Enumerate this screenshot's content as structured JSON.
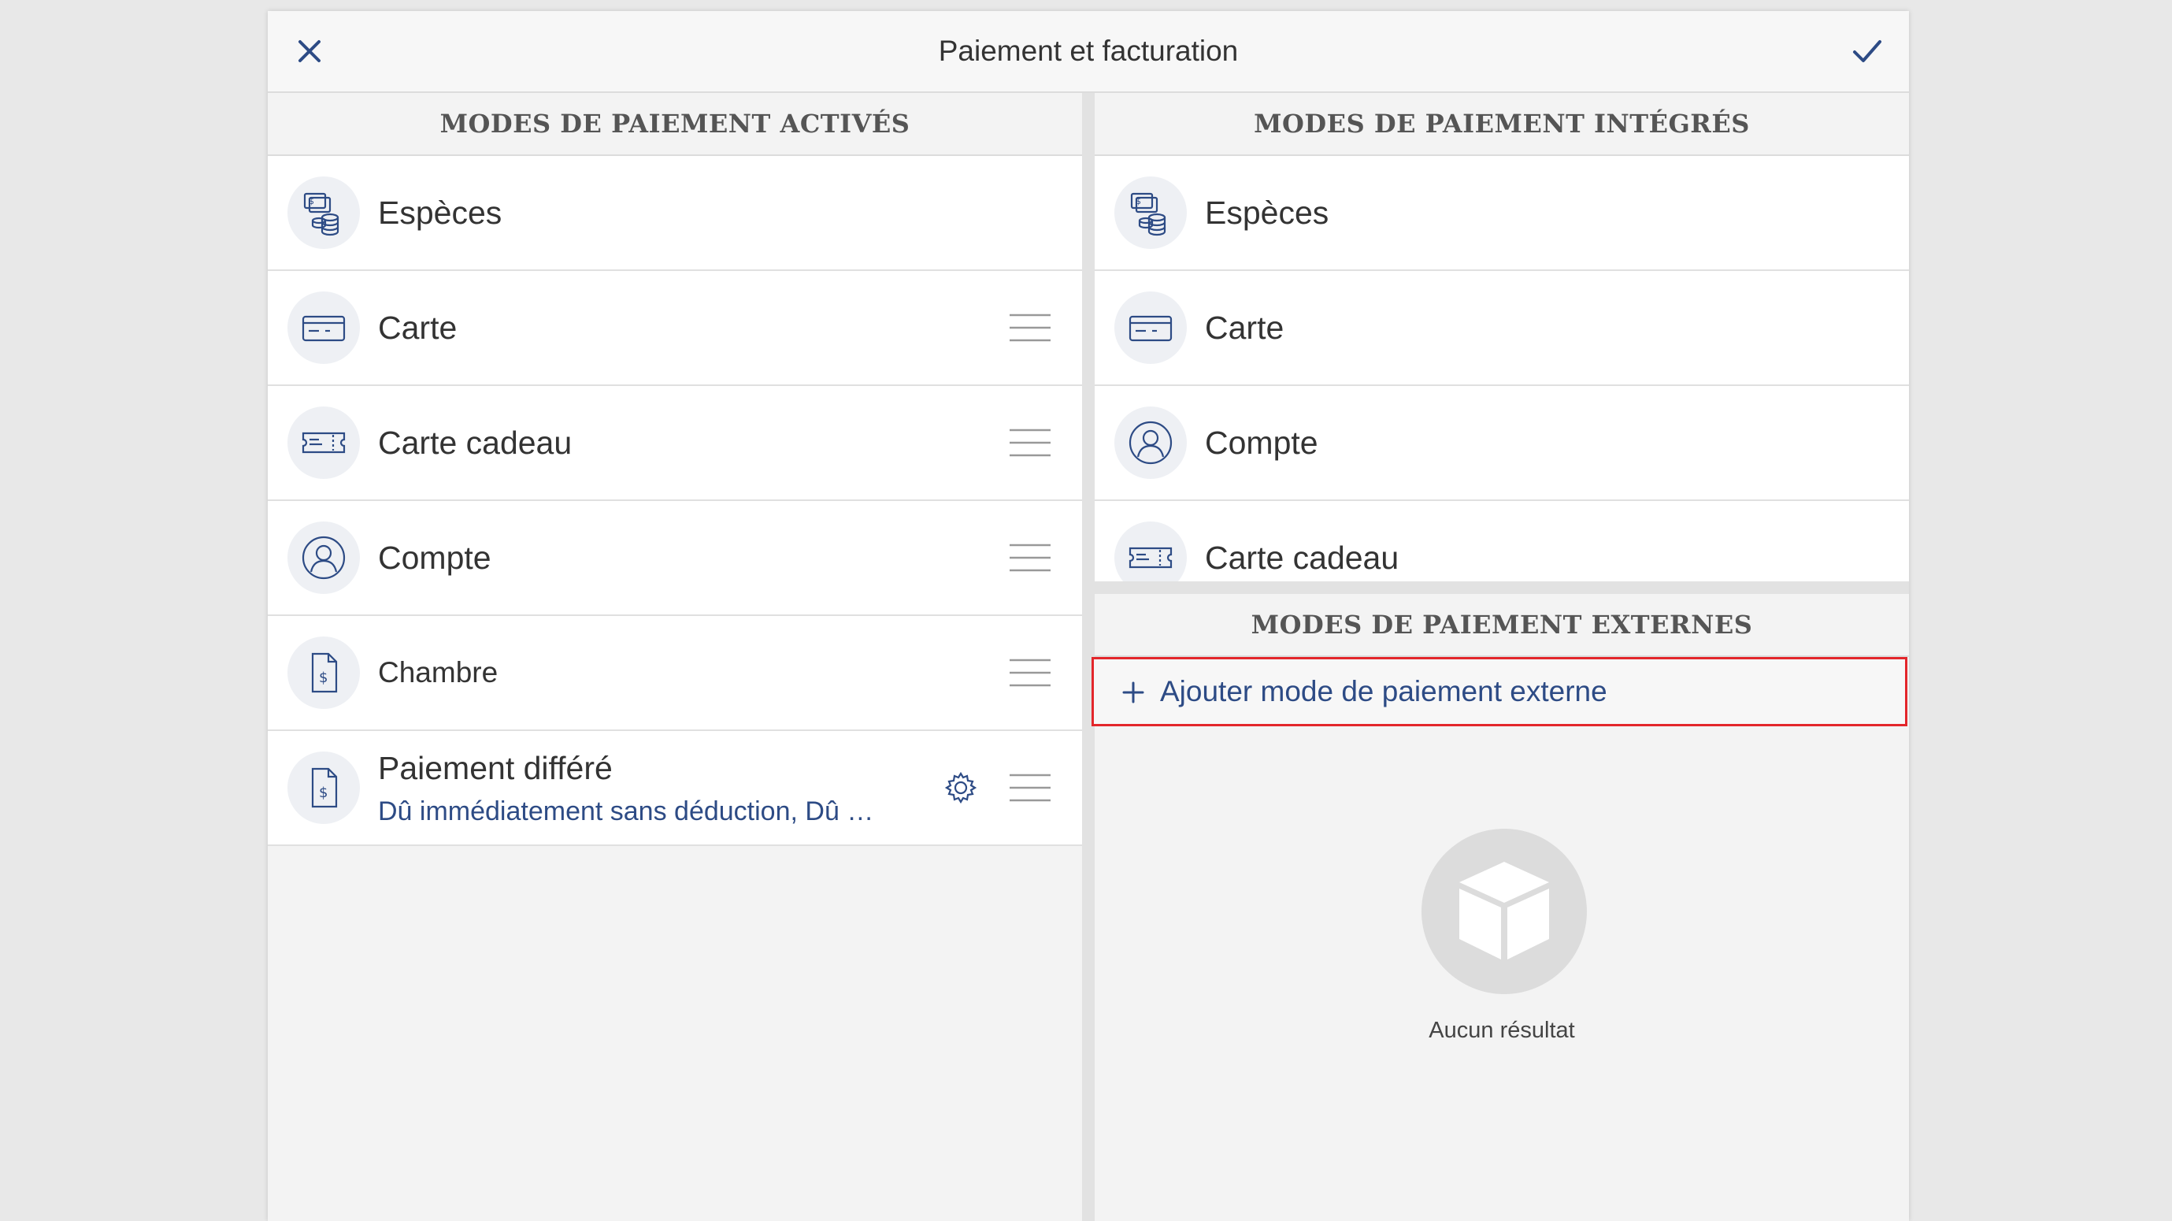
{
  "window": {
    "title": "Paiement et facturation"
  },
  "enabled": {
    "header": "MODES DE PAIEMENT ACTIVÉS",
    "items": [
      {
        "label": "Espèces",
        "icon": "cash-icon"
      },
      {
        "label": "Carte",
        "icon": "credit-card-icon"
      },
      {
        "label": "Carte cadeau",
        "icon": "gift-card-icon"
      },
      {
        "label": "Compte",
        "icon": "account-icon"
      },
      {
        "label": "Chambre",
        "icon": "invoice-icon"
      },
      {
        "label": "Paiement différé",
        "sub": "Dû immédiatement sans déduction, Dû immé...",
        "icon": "invoice-icon"
      }
    ]
  },
  "integrated": {
    "header": "MODES DE PAIEMENT INTÉGRÉS",
    "items": [
      {
        "label": "Espèces",
        "icon": "cash-icon"
      },
      {
        "label": "Carte",
        "icon": "credit-card-icon"
      },
      {
        "label": "Compte",
        "icon": "account-icon"
      },
      {
        "label": "Carte cadeau",
        "icon": "gift-card-icon"
      }
    ]
  },
  "external": {
    "header": "MODES DE PAIEMENT EXTERNES",
    "add_label": "Ajouter mode de paiement externe",
    "empty_text": "Aucun résultat"
  },
  "colors": {
    "accent": "#2d4b85",
    "highlight": "#e3262b",
    "icon_bg": "#eef0f4"
  }
}
